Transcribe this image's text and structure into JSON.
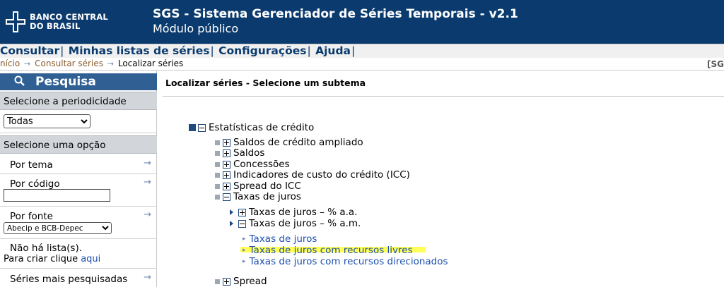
{
  "header": {
    "logo_line1": "BANCO CENTRAL",
    "logo_line2": "DO BRASIL",
    "title": "SGS - Sistema Gerenciador de Séries Temporais - v2.1",
    "subtitle": "Módulo público",
    "bg_color": "#0b3b6e"
  },
  "menu": {
    "items": [
      "Consultar",
      "Minhas listas de séries",
      "Configurações",
      "Ajuda"
    ],
    "separator": "|"
  },
  "breadcrumb": {
    "items": [
      "nício",
      "Consultar séries"
    ],
    "current": "Localizar séries",
    "right_text": "[SG"
  },
  "sidebar": {
    "search_title": "Pesquisa",
    "periodicity_header": "Selecione a periodicidade",
    "periodicity_value": "Todas",
    "option_header": "Selecione uma opção",
    "by_theme": "Por tema",
    "by_code": "Por código",
    "by_source": "Por fonte",
    "source_value": "Abecip e BCB-Depec",
    "no_list_text": "Não há lista(s).",
    "create_text": "Para criar clique",
    "create_link": "aqui",
    "most_searched": "Séries mais pesquisadas"
  },
  "content": {
    "title": "Localizar séries - Selecione um subtema",
    "root": "Estatísticas de crédito",
    "children": [
      "Saldos de crédito ampliado",
      "Saldos",
      "Concessões",
      "Indicadores de custo do crédito (ICC)",
      "Spread do ICC",
      "Taxas de juros"
    ],
    "rates": [
      "Taxas de juros – %  a.a.",
      "Taxas de juros – %  a.m."
    ],
    "leaves": [
      "Taxas de juros",
      "Taxas de juros com recursos livres",
      "Taxas de juros com recursos direcionados"
    ],
    "last": "Spread",
    "highlight_color": "#ffff3a"
  }
}
